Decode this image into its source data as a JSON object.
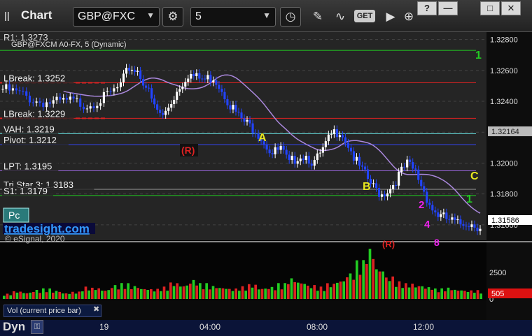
{
  "toolbar": {
    "grip": "||",
    "title": "Chart",
    "symbol": "GBP@FXC",
    "interval": "5",
    "get_label": "GET",
    "window_buttons": [
      "?",
      "—",
      "□",
      "✕"
    ]
  },
  "study_header": "GBP@FXCM A0-FX, 5 (Dynamic)",
  "levels": [
    {
      "label": "R1: 1.3273",
      "price": 1.3273,
      "color": "#22cc22"
    },
    {
      "label": "LBreak: 1.3252",
      "price": 1.3252,
      "color": "#dd2222"
    },
    {
      "label": "LBreak: 1.3229",
      "price": 1.3229,
      "color": "#dd2222"
    },
    {
      "label": "VAH: 1.3219",
      "price": 1.3219,
      "color": "#66dddd"
    },
    {
      "label": "Pivot: 1.3212",
      "price": 1.3212,
      "color": "#3344ee"
    },
    {
      "label": "LPT: 1.3195",
      "price": 1.3195,
      "color": "#9966dd"
    },
    {
      "label": "Tri Star 3: 1.3183",
      "price": 1.3183,
      "color": "#999999"
    },
    {
      "label": "S1: 1.3179",
      "price": 1.3179,
      "color": "#22cc22"
    }
  ],
  "price_axis": {
    "ticks": [
      "1.32800",
      "1.32600",
      "1.32400",
      "1.32200",
      "1.32000",
      "1.31800",
      "1.31600"
    ],
    "ma_tag": "1.32164",
    "last_price_tag": "1.31586"
  },
  "volume_axis": {
    "ticks": [
      "2500",
      "0"
    ],
    "last_tag": "505"
  },
  "time_axis": {
    "ticks": [
      "19",
      "04:00",
      "08:00",
      "12:00"
    ]
  },
  "markers": {
    "A": "A",
    "B": "B",
    "C": "C",
    "R1": "(R)",
    "R2": "(R)",
    "seq": [
      "1",
      "2",
      "4",
      "8",
      "1",
      "1"
    ]
  },
  "branding": {
    "pc_badge": "Pc",
    "site": "tradesight.com",
    "copyright": "© eSignal, 2020"
  },
  "volume_label": "Vol (current price bar)",
  "volume_close": "✖",
  "status_bar": {
    "dyn": "Dyn",
    "lock": "⚿"
  },
  "chart_data": {
    "type": "candlestick",
    "symbol": "GBP@FXC",
    "interval": "5",
    "ylim": [
      1.315,
      1.3283
    ],
    "x": [
      "19",
      "04:00",
      "08:00",
      "12:00"
    ],
    "price_path": [
      [
        0,
        1.3248
      ],
      [
        4,
        1.3245
      ],
      [
        8,
        1.324
      ],
      [
        12,
        1.3239
      ],
      [
        16,
        1.324
      ],
      [
        20,
        1.3238
      ],
      [
        24,
        1.3242
      ],
      [
        28,
        1.325
      ],
      [
        30,
        1.3262
      ],
      [
        32,
        1.326
      ],
      [
        34,
        1.325
      ],
      [
        36,
        1.3236
      ],
      [
        38,
        1.323
      ],
      [
        40,
        1.324
      ],
      [
        42,
        1.325
      ],
      [
        44,
        1.3258
      ],
      [
        46,
        1.3255
      ],
      [
        48,
        1.3254
      ],
      [
        50,
        1.3256
      ],
      [
        52,
        1.3248
      ],
      [
        54,
        1.3238
      ],
      [
        56,
        1.323
      ],
      [
        58,
        1.3225
      ],
      [
        60,
        1.3222
      ],
      [
        62,
        1.3214
      ],
      [
        64,
        1.3206
      ],
      [
        66,
        1.3209
      ],
      [
        68,
        1.3199
      ],
      [
        70,
        1.3205
      ],
      [
        72,
        1.3205
      ],
      [
        74,
        1.32
      ],
      [
        76,
        1.3208
      ],
      [
        78,
        1.3218
      ],
      [
        80,
        1.3222
      ],
      [
        82,
        1.3212
      ],
      [
        84,
        1.32
      ],
      [
        86,
        1.3192
      ],
      [
        88,
        1.3184
      ],
      [
        90,
        1.318
      ],
      [
        92,
        1.3184
      ],
      [
        94,
        1.3192
      ],
      [
        96,
        1.3199
      ],
      [
        98,
        1.3194
      ],
      [
        100,
        1.3182
      ],
      [
        102,
        1.317
      ],
      [
        104,
        1.3165
      ],
      [
        106,
        1.3163
      ],
      [
        108,
        1.316
      ],
      [
        110,
        1.3162
      ],
      [
        112,
        1.316
      ],
      [
        114,
        1.3159
      ]
    ],
    "volume": [
      300,
      450,
      380,
      520,
      600,
      480,
      350,
      420,
      700,
      650,
      540,
      800,
      900,
      760,
      620,
      580,
      700,
      950,
      820,
      1100,
      900,
      760,
      680,
      600,
      720,
      850,
      640,
      700,
      900,
      1200,
      1000,
      800,
      700,
      900,
      1100,
      1500,
      2200,
      2900,
      1800,
      1300,
      1000,
      900,
      800,
      700,
      600,
      650,
      550,
      500,
      505
    ]
  }
}
